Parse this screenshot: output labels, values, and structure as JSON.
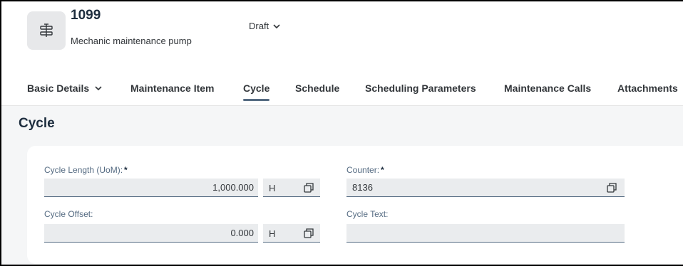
{
  "header": {
    "object_id": "1099",
    "description": "Mechanic maintenance pump",
    "status": "Draft"
  },
  "tabs": [
    {
      "label": "Basic Details",
      "has_dropdown": true,
      "selected": false
    },
    {
      "label": "Maintenance Item",
      "selected": false
    },
    {
      "label": "Cycle",
      "selected": true
    },
    {
      "label": "Schedule",
      "selected": false
    },
    {
      "label": "Scheduling Parameters",
      "selected": false
    },
    {
      "label": "Maintenance Calls",
      "selected": false
    },
    {
      "label": "Attachments",
      "selected": false
    }
  ],
  "section": {
    "title": "Cycle",
    "fields": {
      "cycle_length": {
        "label": "Cycle Length (UoM):",
        "required": "*",
        "value": "1,000.000",
        "unit": "H"
      },
      "counter": {
        "label": "Counter:",
        "required": "*",
        "value": "8136"
      },
      "cycle_offset": {
        "label": "Cycle Offset:",
        "value": "0.000",
        "unit": "H"
      },
      "cycle_text": {
        "label": "Cycle Text:",
        "value": ""
      }
    }
  },
  "colors": {
    "accent": "#556b82",
    "title": "#1d2d3e",
    "field_bg": "#eaecee",
    "page_bg": "#f5f6f7"
  }
}
